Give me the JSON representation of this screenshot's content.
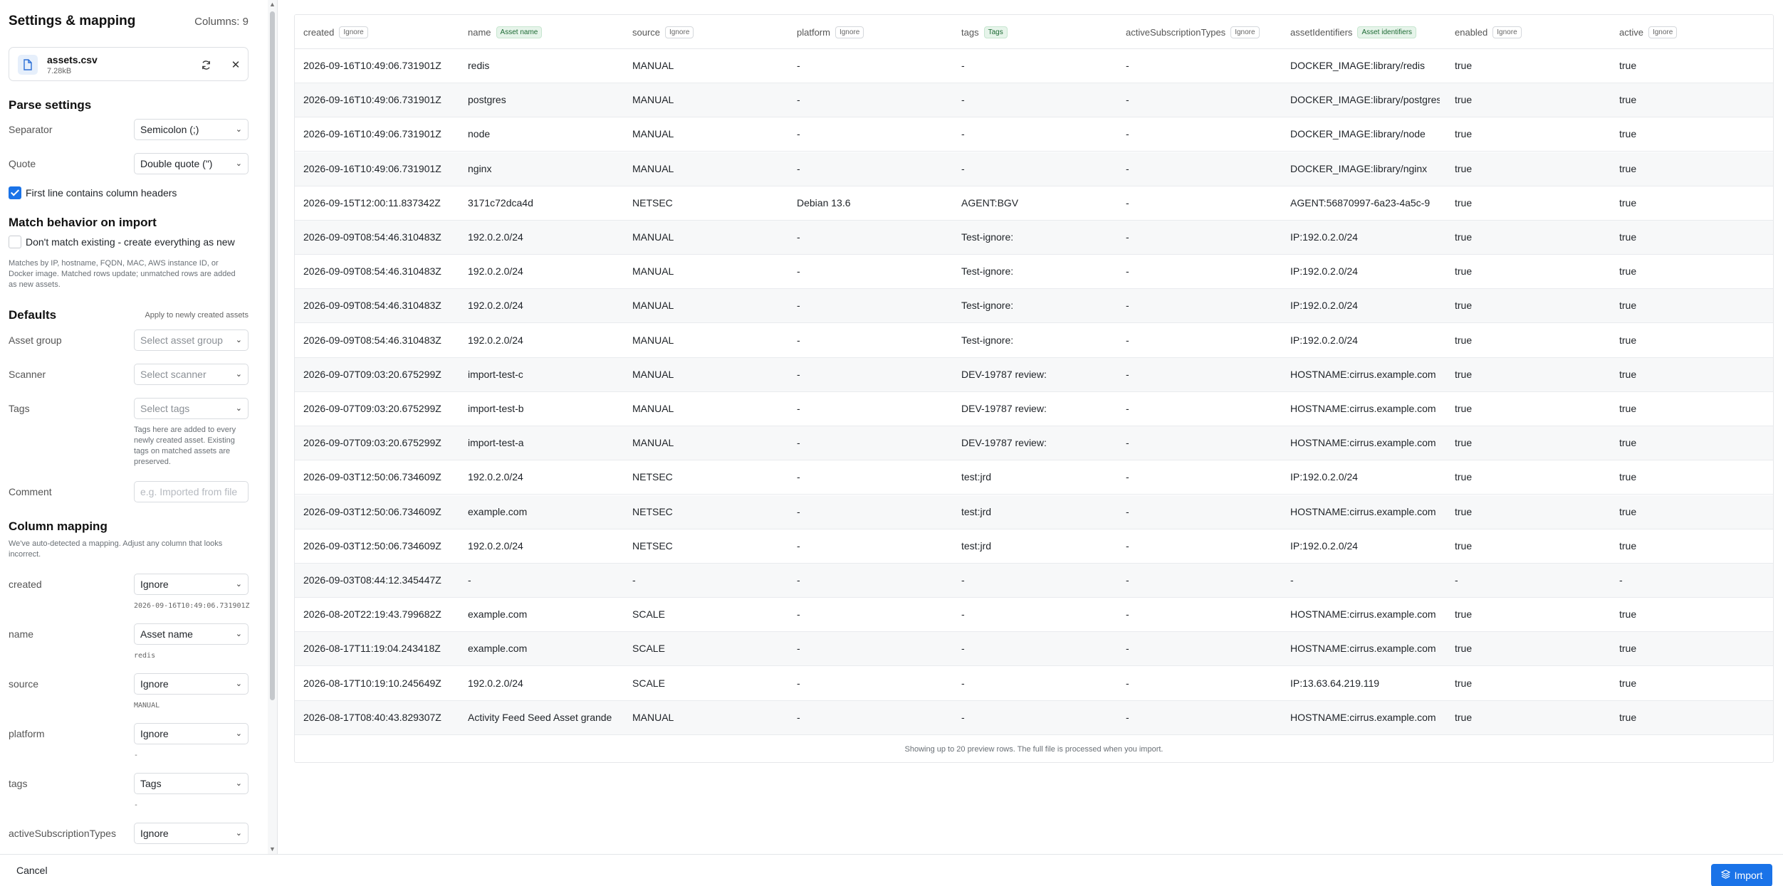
{
  "panel": {
    "title": "Settings & mapping",
    "columns_count": "Columns: 9"
  },
  "file": {
    "name": "assets.csv",
    "size": "7.28kB"
  },
  "parse": {
    "title": "Parse settings",
    "separator_label": "Separator",
    "separator_value": "Semicolon (;)",
    "quote_label": "Quote",
    "quote_value": "Double quote (\")",
    "headers_label": "First line contains column headers"
  },
  "match": {
    "title": "Match behavior on import",
    "dont_match_label": "Don't match existing - create everything as new",
    "help": "Matches by IP, hostname, FQDN, MAC, AWS instance ID, or Docker image. Matched rows update; unmatched rows are added as new assets."
  },
  "defaults": {
    "title": "Defaults",
    "note": "Apply to newly created assets",
    "asset_group_label": "Asset group",
    "asset_group_placeholder": "Select asset group",
    "scanner_label": "Scanner",
    "scanner_placeholder": "Select scanner",
    "tags_label": "Tags",
    "tags_placeholder": "Select tags",
    "tags_help": "Tags here are added to every newly created asset. Existing tags on matched assets are preserved.",
    "comment_label": "Comment",
    "comment_placeholder": "e.g. Imported from file"
  },
  "mapping": {
    "title": "Column mapping",
    "help": "We've auto-detected a mapping. Adjust any column that looks incorrect.",
    "items": [
      {
        "column": "created",
        "value": "Ignore",
        "sample": "2026-09-16T10:49:06.731901Z"
      },
      {
        "column": "name",
        "value": "Asset name",
        "sample": "redis"
      },
      {
        "column": "source",
        "value": "Ignore",
        "sample": "MANUAL"
      },
      {
        "column": "platform",
        "value": "Ignore",
        "sample": "-"
      },
      {
        "column": "tags",
        "value": "Tags",
        "sample": "-"
      },
      {
        "column": "activeSubscriptionTypes",
        "value": "Ignore",
        "sample": ""
      }
    ]
  },
  "table": {
    "columns": [
      {
        "name": "created",
        "badge": "Ignore",
        "mapped": false
      },
      {
        "name": "name",
        "badge": "Asset name",
        "mapped": true
      },
      {
        "name": "source",
        "badge": "Ignore",
        "mapped": false
      },
      {
        "name": "platform",
        "badge": "Ignore",
        "mapped": false
      },
      {
        "name": "tags",
        "badge": "Tags",
        "mapped": true
      },
      {
        "name": "activeSubscriptionTypes",
        "badge": "Ignore",
        "mapped": false
      },
      {
        "name": "assetIdentifiers",
        "badge": "Asset identifiers",
        "mapped": true
      },
      {
        "name": "enabled",
        "badge": "Ignore",
        "mapped": false
      },
      {
        "name": "active",
        "badge": "Ignore",
        "mapped": false
      }
    ],
    "rows": [
      [
        "2026-09-16T10:49:06.731901Z",
        "redis",
        "MANUAL",
        "-",
        "-",
        "-",
        "DOCKER_IMAGE:library/redis",
        "true",
        "true"
      ],
      [
        "2026-09-16T10:49:06.731901Z",
        "postgres",
        "MANUAL",
        "-",
        "-",
        "-",
        "DOCKER_IMAGE:library/postgres",
        "true",
        "true"
      ],
      [
        "2026-09-16T10:49:06.731901Z",
        "node",
        "MANUAL",
        "-",
        "-",
        "-",
        "DOCKER_IMAGE:library/node",
        "true",
        "true"
      ],
      [
        "2026-09-16T10:49:06.731901Z",
        "nginx",
        "MANUAL",
        "-",
        "-",
        "-",
        "DOCKER_IMAGE:library/nginx",
        "true",
        "true"
      ],
      [
        "2026-09-15T12:00:11.837342Z",
        "3171c72dca4d",
        "NETSEC",
        "Debian 13.6",
        "AGENT:BGV",
        "-",
        "AGENT:56870997-6a23-4a5c-9",
        "true",
        "true"
      ],
      [
        "2026-09-09T08:54:46.310483Z",
        "192.0.2.0/24",
        "MANUAL",
        "-",
        "Test-ignore:",
        "-",
        "IP:192.0.2.0/24",
        "true",
        "true"
      ],
      [
        "2026-09-09T08:54:46.310483Z",
        "192.0.2.0/24",
        "MANUAL",
        "-",
        "Test-ignore:",
        "-",
        "IP:192.0.2.0/24",
        "true",
        "true"
      ],
      [
        "2026-09-09T08:54:46.310483Z",
        "192.0.2.0/24",
        "MANUAL",
        "-",
        "Test-ignore:",
        "-",
        "IP:192.0.2.0/24",
        "true",
        "true"
      ],
      [
        "2026-09-09T08:54:46.310483Z",
        "192.0.2.0/24",
        "MANUAL",
        "-",
        "Test-ignore:",
        "-",
        "IP:192.0.2.0/24",
        "true",
        "true"
      ],
      [
        "2026-09-07T09:03:20.675299Z",
        "import-test-c",
        "MANUAL",
        "-",
        "DEV-19787 review:",
        "-",
        "HOSTNAME:cirrus.example.com",
        "true",
        "true"
      ],
      [
        "2026-09-07T09:03:20.675299Z",
        "import-test-b",
        "MANUAL",
        "-",
        "DEV-19787 review:",
        "-",
        "HOSTNAME:cirrus.example.com",
        "true",
        "true"
      ],
      [
        "2026-09-07T09:03:20.675299Z",
        "import-test-a",
        "MANUAL",
        "-",
        "DEV-19787 review:",
        "-",
        "HOSTNAME:cirrus.example.com",
        "true",
        "true"
      ],
      [
        "2026-09-03T12:50:06.734609Z",
        "192.0.2.0/24",
        "NETSEC",
        "-",
        "test:jrd",
        "-",
        "IP:192.0.2.0/24",
        "true",
        "true"
      ],
      [
        "2026-09-03T12:50:06.734609Z",
        "example.com",
        "NETSEC",
        "-",
        "test:jrd",
        "-",
        "HOSTNAME:cirrus.example.com",
        "true",
        "true"
      ],
      [
        "2026-09-03T12:50:06.734609Z",
        "192.0.2.0/24",
        "NETSEC",
        "-",
        "test:jrd",
        "-",
        "IP:192.0.2.0/24",
        "true",
        "true"
      ],
      [
        "2026-09-03T08:44:12.345447Z",
        "-",
        "-",
        "-",
        "-",
        "-",
        "-",
        "-",
        "-"
      ],
      [
        "2026-08-20T22:19:43.799682Z",
        "example.com",
        "SCALE",
        "-",
        "-",
        "-",
        "HOSTNAME:cirrus.example.com",
        "true",
        "true"
      ],
      [
        "2026-08-17T11:19:04.243418Z",
        "example.com",
        "SCALE",
        "-",
        "-",
        "-",
        "HOSTNAME:cirrus.example.com",
        "true",
        "true"
      ],
      [
        "2026-08-17T10:19:10.245649Z",
        "192.0.2.0/24",
        "SCALE",
        "-",
        "-",
        "-",
        "IP:13.63.64.219.119",
        "true",
        "true"
      ],
      [
        "2026-08-17T08:40:43.829307Z",
        "Activity Feed Seed Asset grande",
        "MANUAL",
        "-",
        "-",
        "-",
        "HOSTNAME:cirrus.example.com",
        "true",
        "true"
      ]
    ],
    "footer": "Showing up to 20 preview rows. The full file is processed when you import."
  },
  "actions": {
    "cancel": "Cancel",
    "import": "Import"
  },
  "colors": {
    "primary": "#1a73e8",
    "mapped_badge_bg": "#e6f4ea",
    "mapped_badge_text": "#1e6b35"
  }
}
